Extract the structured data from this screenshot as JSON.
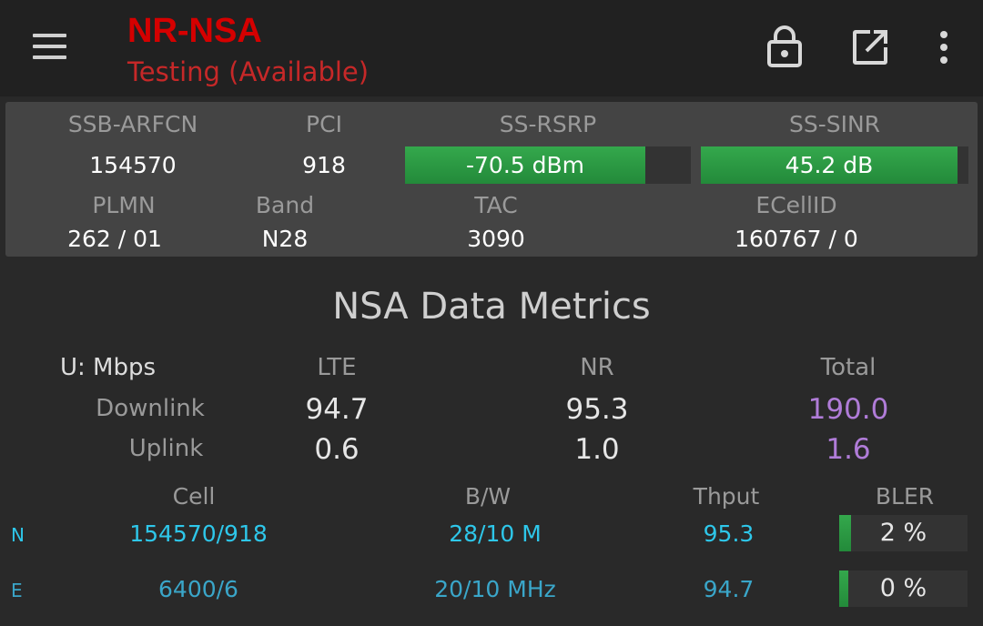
{
  "appbar": {
    "title": "NR-NSA",
    "subtitle": "Testing (Available)",
    "icons": [
      "menu-icon",
      "lock-icon",
      "open-external-icon",
      "more-vert-icon"
    ]
  },
  "panel": {
    "ssb_arfcn": {
      "label": "SSB-ARFCN",
      "value": "154570"
    },
    "pci": {
      "label": "PCI",
      "value": "918"
    },
    "ss_rsrp": {
      "label": "SS-RSRP",
      "value": "-70.5 dBm",
      "level": 0.9
    },
    "ss_sinr": {
      "label": "SS-SINR",
      "value": "45.2 dB",
      "level": 0.96
    },
    "plmn": {
      "label": "PLMN",
      "value": "262 / 01"
    },
    "band": {
      "label": "Band",
      "value": "N28"
    },
    "tac": {
      "label": "TAC",
      "value": "3090"
    },
    "ecellid": {
      "label": "ECellID",
      "value": "160767 / 0"
    }
  },
  "metrics": {
    "title": "NSA Data Metrics",
    "unit_label": "U: Mbps",
    "columns": {
      "lte": "LTE",
      "nr": "NR",
      "total": "Total"
    },
    "downlink": {
      "label": "Downlink",
      "lte": "94.7",
      "nr": "95.3",
      "total": "190.0"
    },
    "uplink": {
      "label": "Uplink",
      "lte": "0.6",
      "nr": "1.0",
      "total": "1.6"
    }
  },
  "cells": {
    "headers": {
      "cell": "Cell",
      "bw": "B/W",
      "thput": "Thput",
      "bler": "BLER"
    },
    "rows": [
      {
        "tag": "N",
        "cell": "154570/918",
        "bw": "28/10 M",
        "thput": "95.3",
        "bler": "2 %",
        "bler_level": 0.02
      },
      {
        "tag": "E",
        "cell": "6400/6",
        "bw": "20/10 MHz",
        "thput": "94.7",
        "bler": "0 %",
        "bler_level": 0.0
      }
    ]
  },
  "colors": {
    "accent_red": "#d50000",
    "bar_green": "#2e9e46",
    "cyan": "#2ec7ea",
    "total_purple": "#b07cd8",
    "background": "#292929"
  }
}
